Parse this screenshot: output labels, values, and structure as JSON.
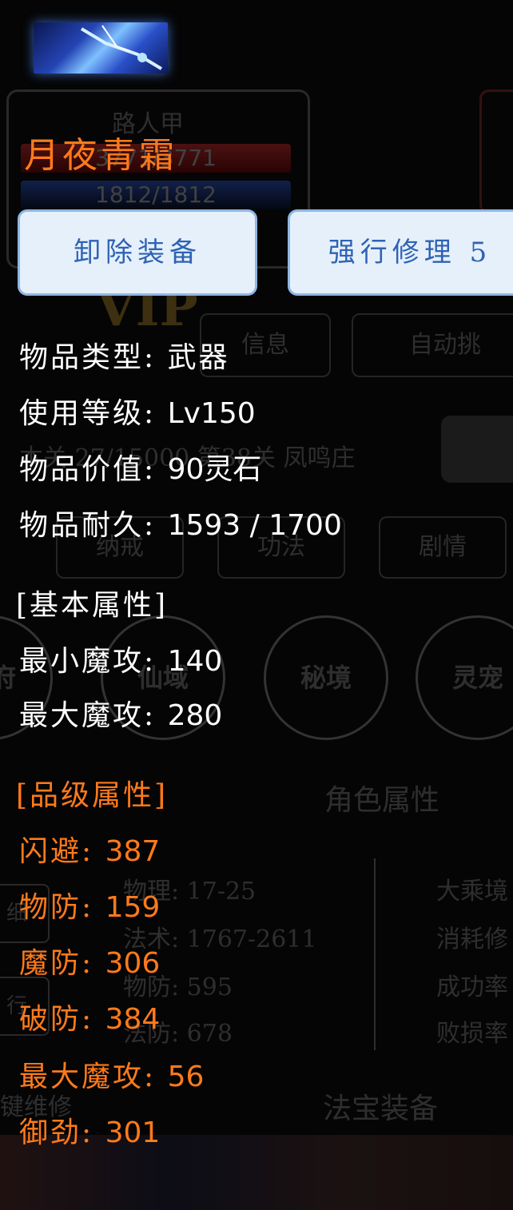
{
  "background": {
    "player_name": "路人甲",
    "hp": "3771/3771",
    "mp": "1812/1812",
    "vip": "VIP",
    "info_button": "信息",
    "auto_button": "自动挑",
    "stage_text": "本关 27/15000 第38关 凤鸣庄",
    "tabs": [
      "纳戒",
      "功法",
      "剧情"
    ],
    "circles": [
      "洞府",
      "仙域",
      "秘境",
      "灵宠"
    ],
    "attributes_heading": "角色属性",
    "stats_left": [
      "物理: 17-25",
      "法术: 1767-2611",
      "物防: 595",
      "法防: 678"
    ],
    "stats_right": [
      "大乘境",
      "消耗修",
      "成功率",
      "败损率"
    ],
    "side_buttons": [
      "细",
      "行",
      "键维修"
    ],
    "treasure_heading": "法宝装备"
  },
  "item": {
    "icon": "sword-icon",
    "name": "月夜青霜"
  },
  "buttons": {
    "unequip": "卸除装备",
    "repair": "强行修理 5"
  },
  "details": {
    "type_label": "物品类型:",
    "type_value": "武器",
    "level_label": "使用等级:",
    "level_value": "Lv150",
    "value_label": "物品价值:",
    "value_value": "90灵石",
    "durability_label": "物品耐久:",
    "durability_value": "1593 / 1700"
  },
  "basic": {
    "heading": "[基本属性]",
    "min_label": "最小魔攻:",
    "min_value": "140",
    "max_label": "最大魔攻:",
    "max_value": "280"
  },
  "quality": {
    "heading": "[品级属性]",
    "rows": [
      {
        "label": "闪避:",
        "value": "387"
      },
      {
        "label": "物防:",
        "value": "159"
      },
      {
        "label": "魔防:",
        "value": "306"
      },
      {
        "label": "破防:",
        "value": "384"
      },
      {
        "label": "最大魔攻:",
        "value": "56"
      },
      {
        "label": "御劲:",
        "value": "301"
      }
    ]
  },
  "colors": {
    "title_orange": "#ff7a1a",
    "button_text": "#2e63b4",
    "button_bg": "#e6f0fb"
  }
}
